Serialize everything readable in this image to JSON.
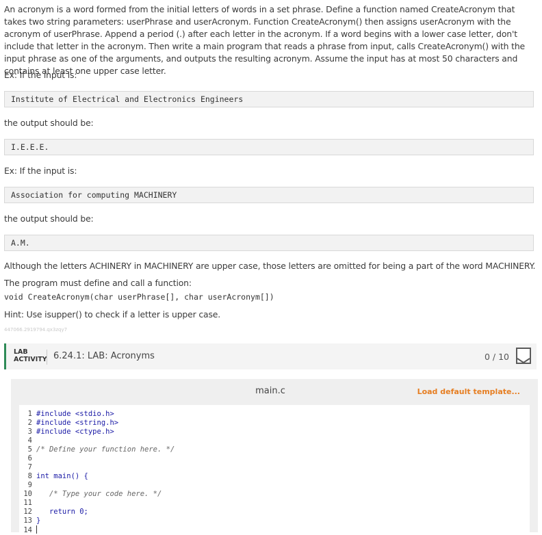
{
  "description": {
    "paragraph": "An acronym is a word formed from the initial letters of words in a set phrase. Define a function named CreateAcronym that takes two string parameters: userPhrase and userAcronym. Function CreateAcronym() then assigns userAcronym with the acronym of userPhrase. Append a period (.) after each letter in the acronym. If a word begins with a lower case letter, don't include that letter in the acronym. Then write a main program that reads a phrase from input, calls CreateAcronym() with the input phrase as one of the arguments, and outputs the resulting acronym. Assume the input has at most 50 characters and contains at least one upper case letter.",
    "ex1_label": "Ex: If the input is:",
    "ex1_input": "Institute of Electrical and Electronics Engineers",
    "ex1_output_label": "the output should be:",
    "ex1_output": "I.E.E.E.",
    "ex2_label": "Ex: If the input is:",
    "ex2_input": "Association for computing MACHINERY",
    "ex2_output_label": "the output should be:",
    "ex2_output": "A.M.",
    "note": "Although the letters ACHINERY in MACHINERY are upper case, those letters are omitted for being a part of the word MACHINERY.",
    "define_text": "The program must define and call a function:",
    "signature": "void CreateAcronym(char userPhrase[], char userAcronym[])",
    "hint": "Hint: Use isupper() to check if a letter is upper case.",
    "id": "447066.2919794.qx3zqy7"
  },
  "lab": {
    "label_line1": "LAB",
    "label_line2": "ACTIVITY",
    "title": "6.24.1: LAB: Acronyms",
    "score": "0 / 10"
  },
  "editor": {
    "file_name": "main.c",
    "load_template": "Load default template...",
    "lines": [
      {
        "n": "1",
        "code": "#include <stdio.h>"
      },
      {
        "n": "2",
        "code": "#include <string.h>"
      },
      {
        "n": "3",
        "code": "#include <ctype.h>"
      },
      {
        "n": "4",
        "code": ""
      },
      {
        "n": "5",
        "code": "/* Define your function here. */"
      },
      {
        "n": "6",
        "code": ""
      },
      {
        "n": "7",
        "code": ""
      },
      {
        "n": "8",
        "code": "int main() {"
      },
      {
        "n": "9",
        "code": ""
      },
      {
        "n": "10",
        "code": "   /* Type your code here. */"
      },
      {
        "n": "11",
        "code": ""
      },
      {
        "n": "12",
        "code": "   return 0;"
      },
      {
        "n": "13",
        "code": "}"
      },
      {
        "n": "14",
        "code": ""
      }
    ]
  }
}
